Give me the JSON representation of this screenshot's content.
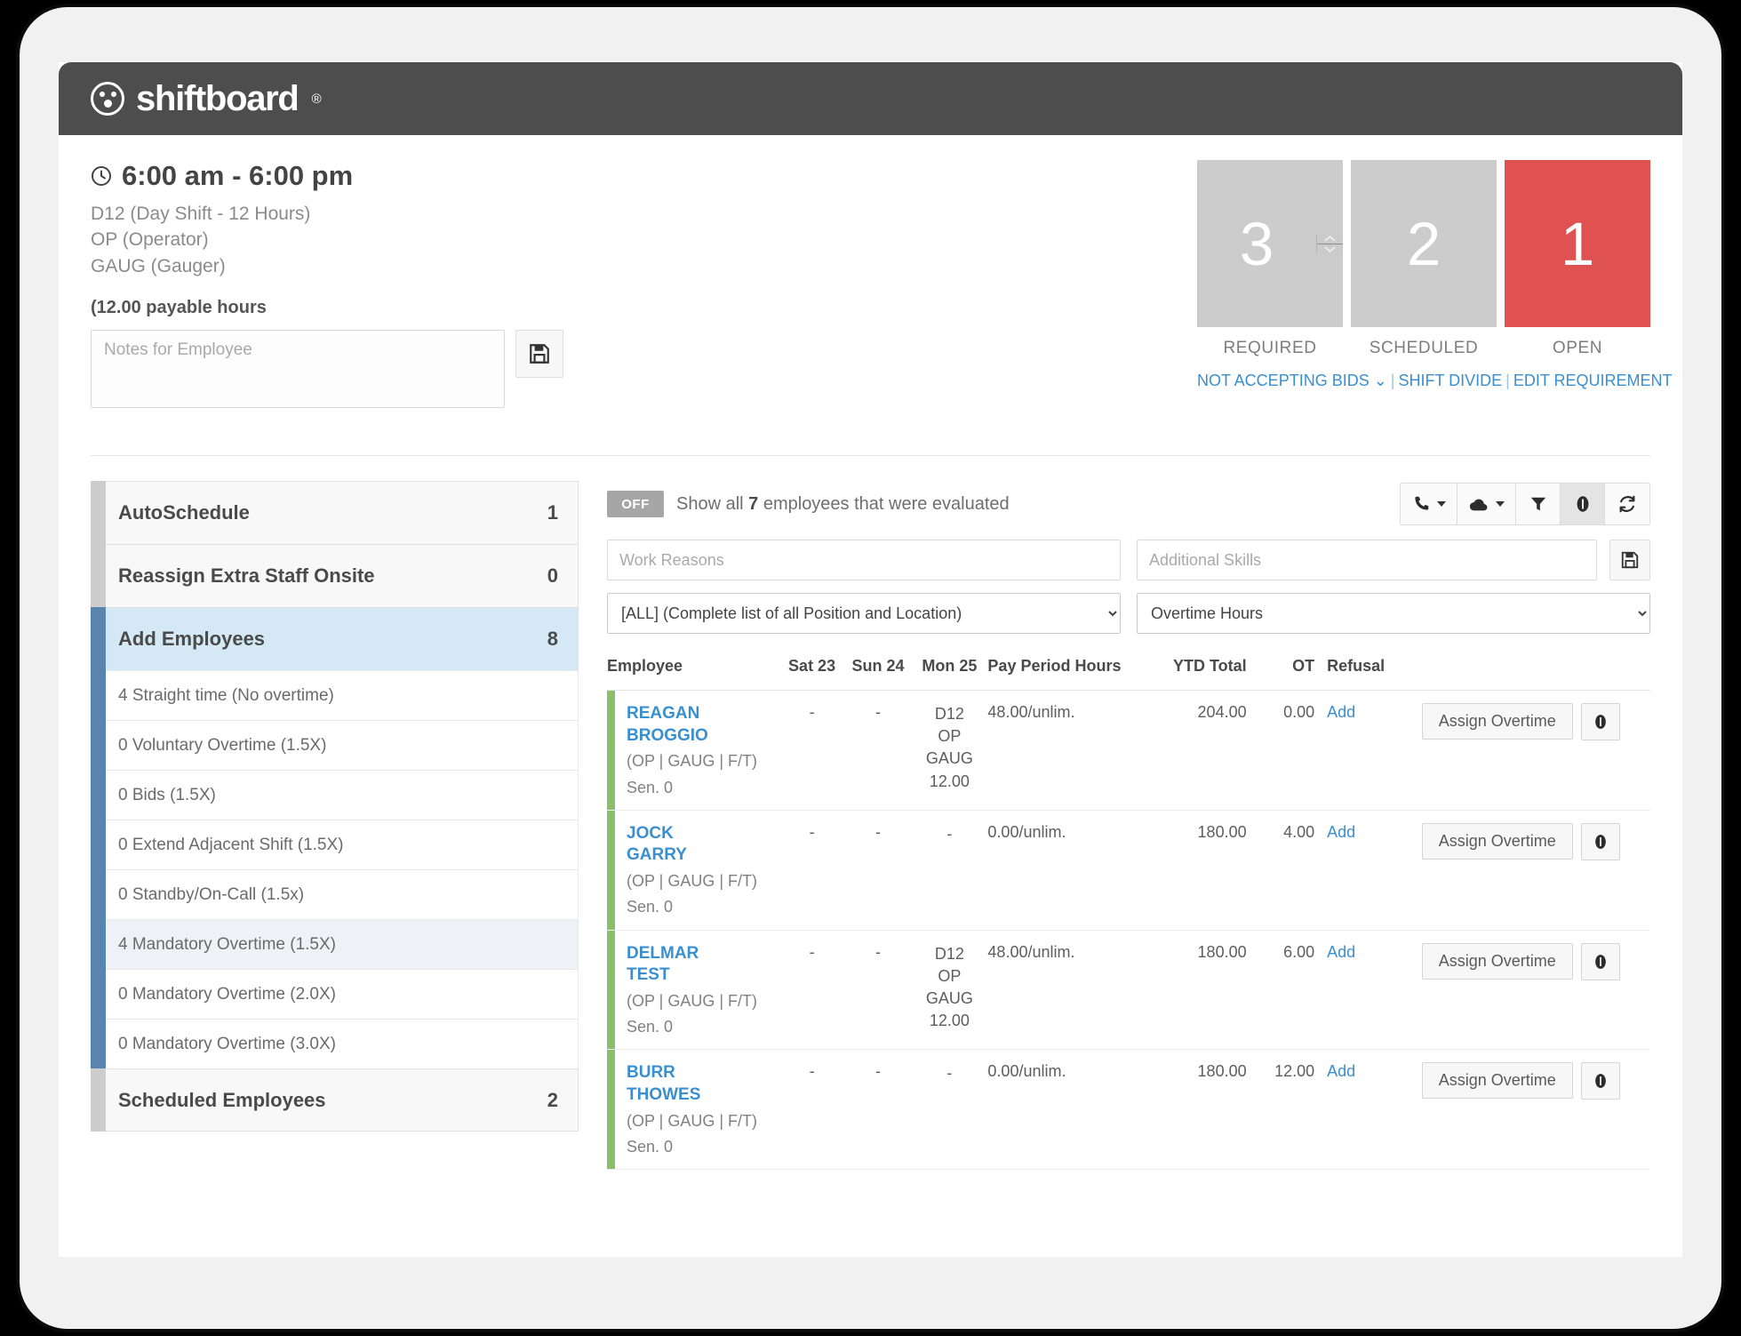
{
  "brand": {
    "name": "shiftboard",
    "registered": "®",
    "logo_icon": "shiftboard-logo-icon"
  },
  "shift": {
    "time_range": "6:00 am - 6:00 pm",
    "clock_icon": "clock-icon",
    "shift_code": "D12 (Day Shift - 12 Hours)",
    "position": "OP (Operator)",
    "skill": "GAUG (Gauger)",
    "payable_hours": "(12.00 payable hours",
    "notes_placeholder": "Notes for Employee",
    "notes_value": "",
    "save_icon": "save-disk-icon"
  },
  "stats": {
    "required": {
      "value": "3",
      "label": "REQUIRED"
    },
    "scheduled": {
      "value": "2",
      "label": "SCHEDULED"
    },
    "open": {
      "value": "1",
      "label": "OPEN",
      "color": "#e05252"
    },
    "spinner_up_icon": "chevron-up-icon",
    "spinner_down_icon": "chevron-down-icon",
    "links": {
      "bids": "NOT ACCEPTING BIDS",
      "bids_caret_icon": "chevron-down-icon",
      "shift_divide": "SHIFT DIVIDE",
      "edit_requirement": "EDIT REQUIREMENT",
      "separator": "|"
    }
  },
  "left_panel": {
    "items": [
      {
        "label": "AutoSchedule",
        "count": "1"
      },
      {
        "label": "Reassign Extra Staff Onsite",
        "count": "0"
      },
      {
        "label": "Add Employees",
        "count": "8"
      }
    ],
    "sub_items": [
      {
        "text": "4 Straight time (No overtime)"
      },
      {
        "text": "0 Voluntary Overtime (1.5X)"
      },
      {
        "text": "0 Bids (1.5X)"
      },
      {
        "text": "0 Extend Adjacent Shift (1.5X)"
      },
      {
        "text": "0 Standby/On-Call (1.5x)"
      },
      {
        "text": "4 Mandatory Overtime (1.5X)"
      },
      {
        "text": "0 Mandatory Overtime (2.0X)"
      },
      {
        "text": "0 Mandatory Overtime (3.0X)"
      }
    ],
    "footer": {
      "label": "Scheduled Employees",
      "count": "2"
    }
  },
  "toolbar": {
    "toggle_state": "OFF",
    "show_all_prefix": "Show all ",
    "show_all_count": "7",
    "show_all_suffix": " employees that were evaluated",
    "icons": [
      {
        "name": "phone-icon",
        "glyph": "phone",
        "has_caret": true,
        "active": false
      },
      {
        "name": "cloud-icon",
        "glyph": "cloud",
        "has_caret": true,
        "active": false
      },
      {
        "name": "filter-funnel-icon",
        "glyph": "funnel",
        "has_caret": false,
        "active": false
      },
      {
        "name": "info-icon",
        "glyph": "info",
        "has_caret": false,
        "active": true
      },
      {
        "name": "refresh-icon",
        "glyph": "refresh",
        "has_caret": false,
        "active": false
      }
    ]
  },
  "filters": {
    "work_reasons_placeholder": "Work Reasons",
    "work_reasons_value": "",
    "additional_skills_placeholder": "Additional Skills",
    "additional_skills_value": "",
    "skills_save_icon": "save-disk-icon",
    "position_select": "[ALL] (Complete list of all Position and Location)",
    "overtime_select": "Overtime Hours"
  },
  "table": {
    "headers": [
      "Employee",
      "Sat 23",
      "Sun 24",
      "Mon 25",
      "Pay Period Hours",
      "YTD Total",
      "OT",
      "Refusal"
    ],
    "refusal_link": "Add",
    "assign_button": "Assign Overtime",
    "info_icon": "info-icon",
    "rows": [
      {
        "first_name": "REAGAN",
        "last_name": "BROGGIO",
        "attrs": "(OP | GAUG | F/T)",
        "seniority": "Sen. 0",
        "sat": "-",
        "sun": "-",
        "mon": [
          "D12",
          "OP",
          "GAUG",
          "12.00"
        ],
        "pay_period": "48.00/unlim.",
        "ytd": "204.00",
        "ot": "0.00"
      },
      {
        "first_name": "JOCK",
        "last_name": "GARRY",
        "attrs": "(OP | GAUG | F/T)",
        "seniority": "Sen. 0",
        "sat": "-",
        "sun": "-",
        "mon": [
          "-"
        ],
        "pay_period": "0.00/unlim.",
        "ytd": "180.00",
        "ot": "4.00"
      },
      {
        "first_name": "DELMAR",
        "last_name": "TEST",
        "attrs": "(OP | GAUG | F/T)",
        "seniority": "Sen. 0",
        "sat": "-",
        "sun": "-",
        "mon": [
          "D12",
          "OP",
          "GAUG",
          "12.00"
        ],
        "pay_period": "48.00/unlim.",
        "ytd": "180.00",
        "ot": "6.00"
      },
      {
        "first_name": "BURR",
        "last_name": "THOWES",
        "attrs": "(OP | GAUG | F/T)",
        "seniority": "Sen. 0",
        "sat": "-",
        "sun": "-",
        "mon": [
          "-"
        ],
        "pay_period": "0.00/unlim.",
        "ytd": "180.00",
        "ot": "12.00"
      }
    ]
  }
}
